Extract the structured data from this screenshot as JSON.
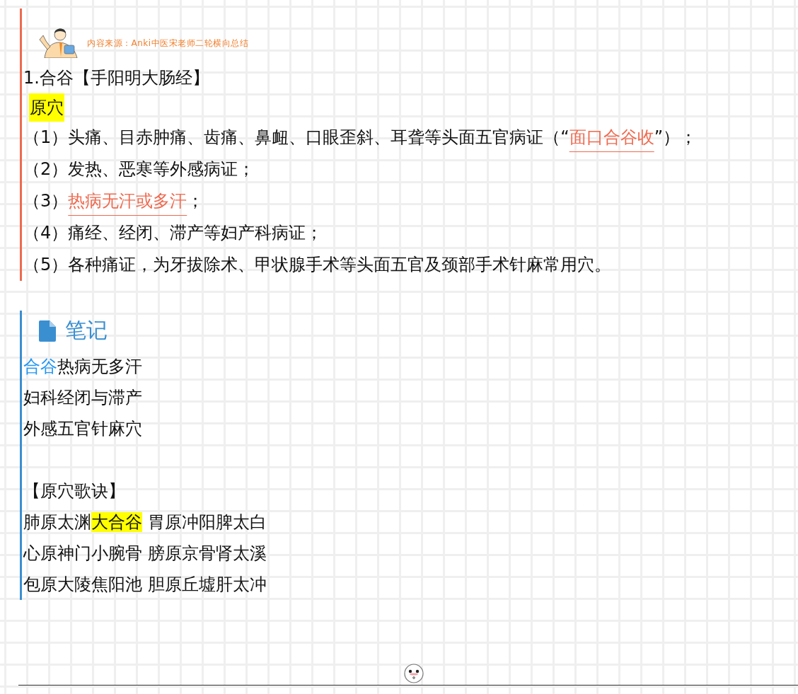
{
  "source": {
    "text": "内容来源：Anki中医宋老师二轮横向总结"
  },
  "title": "1.合谷【手阳明大肠经】",
  "tag": "原穴",
  "items": [
    {
      "segments": [
        {
          "kind": "plain",
          "text": "（1）头痛、目赤肿痛、齿痛、鼻衄、口眼歪斜、耳聋等头面五官病证（“"
        },
        {
          "kind": "emphasis",
          "text": "面口合谷收"
        },
        {
          "kind": "plain",
          "text": "”）；"
        }
      ]
    },
    {
      "segments": [
        {
          "kind": "plain",
          "text": "（2）发热、恶寒等外感病证；"
        }
      ]
    },
    {
      "segments": [
        {
          "kind": "plain",
          "text": "（3）"
        },
        {
          "kind": "emphasis",
          "text": "热病无汗或多汗"
        },
        {
          "kind": "plain",
          "text": "；"
        }
      ]
    },
    {
      "segments": [
        {
          "kind": "plain",
          "text": "（4）痛经、经闭、滞产等妇产科病证；"
        }
      ]
    },
    {
      "segments": [
        {
          "kind": "plain",
          "text": "（5）各种痛证，为牙拔除术、甲状腺手术等头面五官及颈部手术针麻常用穴。"
        }
      ]
    }
  ],
  "notes": {
    "heading": "笔记",
    "lines": [
      {
        "segments": [
          {
            "kind": "accent",
            "text": "合谷"
          },
          {
            "kind": "plain",
            "text": "热病无多汗"
          }
        ]
      },
      {
        "segments": [
          {
            "kind": "plain",
            "text": "妇科经闭与滞产"
          }
        ]
      },
      {
        "segments": [
          {
            "kind": "plain",
            "text": "外感五官针麻穴"
          }
        ]
      }
    ],
    "song_title": "【原穴歌诀】",
    "song_lines": [
      {
        "segments": [
          {
            "kind": "plain",
            "text": "肺原太渊"
          },
          {
            "kind": "highlight",
            "text": "大合谷"
          },
          {
            "kind": "plain",
            "text": " 胃原冲阳脾太白"
          }
        ]
      },
      {
        "segments": [
          {
            "kind": "plain",
            "text": "心原神门小腕骨 膀原京骨肾太溪"
          }
        ]
      },
      {
        "segments": [
          {
            "kind": "plain",
            "text": "包原大陵焦阳池 胆原丘墟肝太冲"
          }
        ]
      }
    ]
  }
}
